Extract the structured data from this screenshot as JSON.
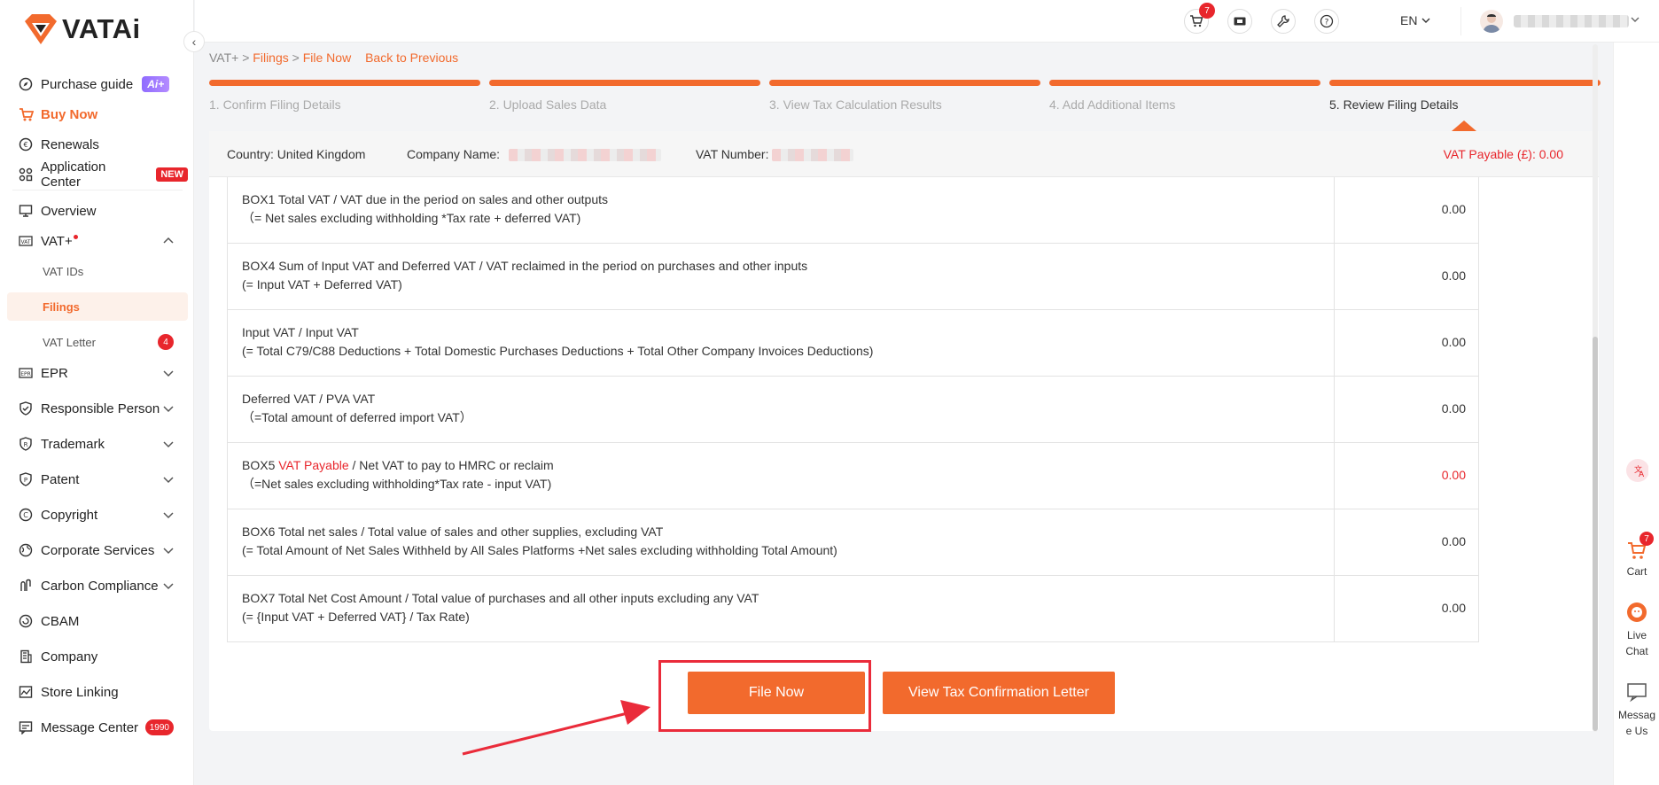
{
  "brand": {
    "name": "VATAi",
    "accent": "#f26a2d",
    "danger": "#e8262c"
  },
  "sidebar": {
    "items": [
      {
        "label": "Purchase guide",
        "icon": "compass-icon",
        "badge": "Ai+"
      },
      {
        "label": "Buy Now",
        "icon": "cart-icon"
      },
      {
        "label": "Renewals",
        "icon": "renew-icon"
      },
      {
        "label": "Application Center",
        "icon": "apps-icon",
        "badge": "NEW"
      },
      {
        "label": "Overview",
        "icon": "monitor-icon"
      },
      {
        "label": "VAT+",
        "icon": "vat-icon"
      },
      {
        "label": "EPR",
        "icon": "epr-icon"
      },
      {
        "label": "Responsible Person",
        "icon": "shield-icon"
      },
      {
        "label": "Trademark",
        "icon": "trademark-icon"
      },
      {
        "label": "Patent",
        "icon": "patent-icon"
      },
      {
        "label": "Copyright",
        "icon": "copyright-icon"
      },
      {
        "label": "Corporate Services",
        "icon": "globe-icon"
      },
      {
        "label": "Carbon Compliance",
        "icon": "carbon-icon"
      },
      {
        "label": "CBAM",
        "icon": "cbam-icon"
      },
      {
        "label": "Company",
        "icon": "building-icon"
      },
      {
        "label": "Store Linking",
        "icon": "store-icon"
      },
      {
        "label": "Message Center",
        "icon": "message-icon",
        "badge": "1990"
      }
    ],
    "vat_sub": [
      {
        "label": "VAT IDs"
      },
      {
        "label": "Filings"
      },
      {
        "label": "VAT Letter",
        "badge": "4"
      }
    ]
  },
  "header": {
    "cart_badge": "7",
    "lang": "EN"
  },
  "breadcrumb": {
    "root": "VAT+",
    "sep": ">",
    "filings": "Filings",
    "current": "File Now",
    "back": "Back to Previous"
  },
  "steps": [
    {
      "label": "1. Confirm Filing Details"
    },
    {
      "label": "2. Upload Sales Data"
    },
    {
      "label": "3. View Tax Calculation Results"
    },
    {
      "label": "4. Add Additional Items"
    },
    {
      "label": "5. Review Filing Details"
    }
  ],
  "info": {
    "country": "Country: United Kingdom",
    "company_label": "Company Name:",
    "vat_number_label": "VAT Number:",
    "vat_payable": "VAT Payable (£): 0.00"
  },
  "rows": [
    {
      "line1": "BOX1 Total VAT / VAT due in the period on sales and other outputs",
      "line2": "（= Net sales excluding withholding *Tax rate + deferred VAT)",
      "value": "0.00"
    },
    {
      "line1": "BOX4 Sum of Input VAT and Deferred VAT / VAT reclaimed in the period on purchases and other inputs",
      "line2": "(= Input VAT + Deferred VAT)",
      "value": "0.00"
    },
    {
      "line1": "Input VAT / Input VAT",
      "line2": "(= Total C79/C88 Deductions + Total Domestic Purchases Deductions + Total Other Company Invoices Deductions)",
      "value": "0.00"
    },
    {
      "line1": "Deferred VAT / PVA VAT",
      "line2": "（=Total amount of deferred import VAT）",
      "value": "0.00"
    },
    {
      "line1_pre": "BOX5 ",
      "line1_red": "VAT Payable",
      "line1_post": " / Net VAT to pay to HMRC or reclaim",
      "line2": "（=Net sales excluding withholding*Tax rate - input VAT)",
      "value": "0.00"
    },
    {
      "line1": "BOX6 Total net sales / Total value of sales and other supplies, excluding VAT",
      "line2": "(= Total Amount of Net Sales Withheld by All Sales Platforms +Net sales excluding withholding Total Amount)",
      "value": "0.00"
    },
    {
      "line1": "BOX7 Total Net Cost Amount / Total value of purchases and all other inputs excluding any VAT",
      "line2": "(= {Input VAT + Deferred VAT} / Tax Rate)",
      "value": "0.00"
    }
  ],
  "actions": {
    "file_now": "File Now",
    "view_letter": "View Tax Confirmation Letter"
  },
  "floatbar": {
    "cart": "Cart",
    "cart_badge": "7",
    "live_chat": "Live Chat",
    "message": "Message Us"
  }
}
